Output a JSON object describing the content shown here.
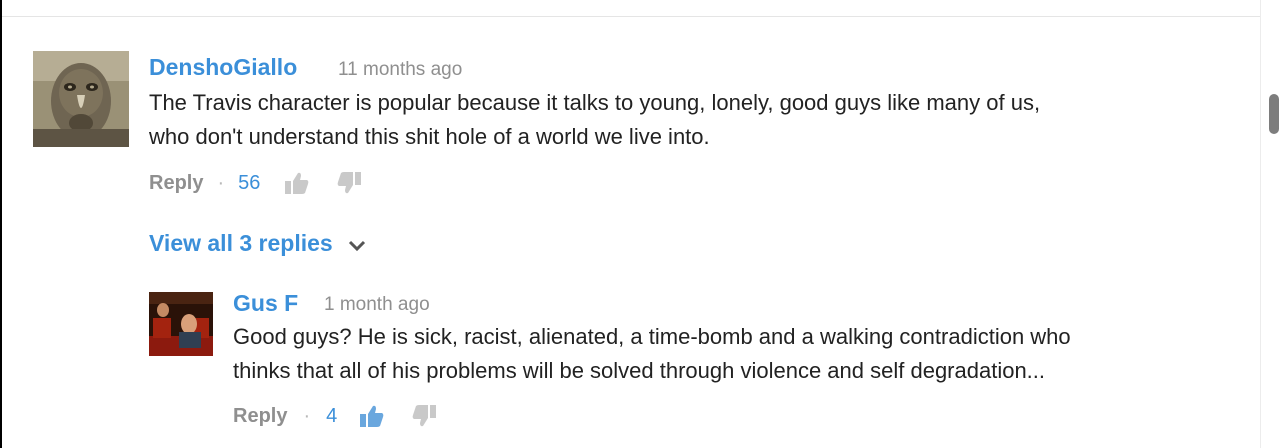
{
  "colors": {
    "accent": "#3b8fd9",
    "text": "#222222",
    "muted": "#8f8f8f",
    "icon_muted": "#c9c9c9",
    "icon_active": "#6aa7de"
  },
  "comment": {
    "author": "DenshoGiallo",
    "time": "11 months ago",
    "text_lines": [
      "The Travis character is popular because it talks to young, lonely, good guys like many of us,",
      "who don't understand this shit hole of a world we live into."
    ],
    "reply_label": "Reply",
    "separator": "·",
    "likes": "56",
    "like_icon": "thumbs-up-icon",
    "dislike_icon": "thumbs-down-icon"
  },
  "view_replies": {
    "label": "View all 3 replies",
    "icon": "chevron-down-icon"
  },
  "reply": {
    "author": "Gus F",
    "time": "1 month ago",
    "text_lines": [
      "Good guys? He is sick, racist, alienated, a time-bomb and a walking contradiction who",
      "thinks that all of his problems will be solved through violence and self degradation..."
    ],
    "reply_label": "Reply",
    "separator": "·",
    "likes": "4",
    "like_icon": "thumbs-up-icon",
    "dislike_icon": "thumbs-down-icon"
  }
}
